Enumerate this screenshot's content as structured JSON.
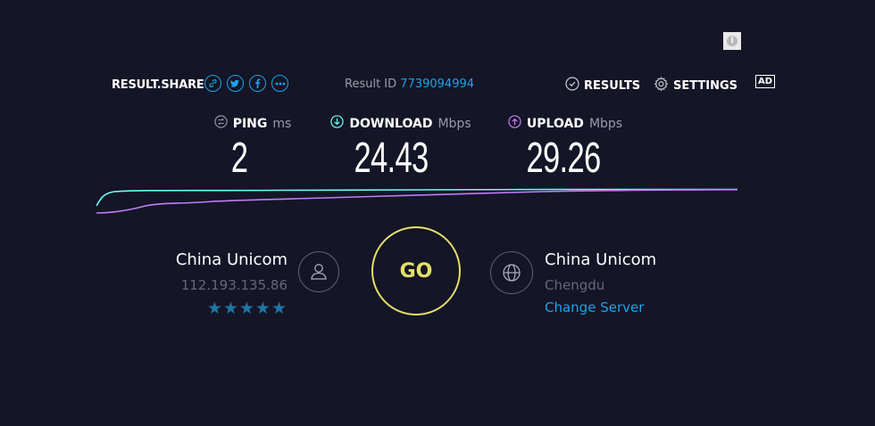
{
  "header": {
    "result_share_label": "RESULT.SHARE",
    "share_icons": [
      "link-icon",
      "twitter-icon",
      "facebook-icon",
      "more-icon"
    ],
    "result_id_label": "Result ID",
    "result_id_value": "7739094994",
    "results_label": "RESULTS",
    "settings_label": "SETTINGS",
    "ad_label": "AD"
  },
  "metrics": {
    "ping": {
      "label": "PING",
      "unit": "ms",
      "value": "2"
    },
    "download": {
      "label": "DOWNLOAD",
      "unit": "Mbps",
      "value": "24.43"
    },
    "upload": {
      "label": "UPLOAD",
      "unit": "Mbps",
      "value": "29.26"
    }
  },
  "isp": {
    "name": "China Unicom",
    "ip": "112.193.135.86",
    "stars": "★★★★★",
    "rating": 5
  },
  "go_label": "GO",
  "server": {
    "name": "China Unicom",
    "location": "Chengdu",
    "change_label": "Change Server"
  },
  "colors": {
    "background": "#141526",
    "accent_blue": "#1ca3ec",
    "go_yellow": "#e3e06a",
    "download_line": "#6afff3",
    "upload_line": "#c27cf6"
  }
}
